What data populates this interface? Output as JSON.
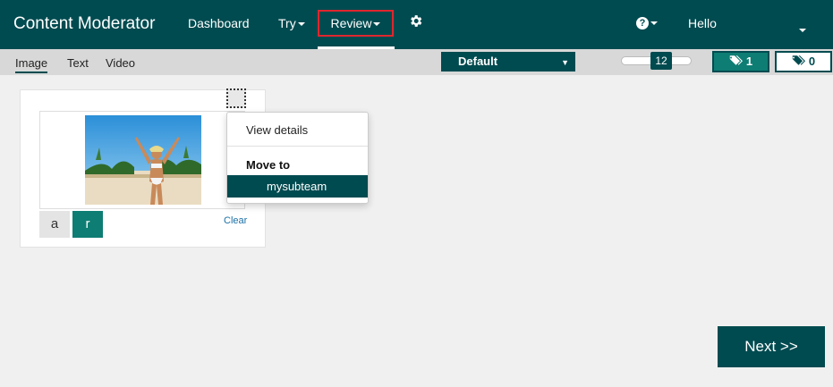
{
  "header": {
    "brand": "Content Moderator",
    "nav": {
      "dashboard": "Dashboard",
      "try": "Try",
      "review": "Review"
    },
    "user_greeting": "Hello"
  },
  "subbar": {
    "media_tabs": [
      "Image",
      "Text",
      "Video"
    ],
    "active_media_tab": "Image",
    "team_select": "Default",
    "page_size": "12",
    "tag_count_on": "1",
    "tag_count_off": "0"
  },
  "card": {
    "tag_a": "a",
    "tag_r": "r",
    "clear_label": "Clear"
  },
  "context_menu": {
    "view_details": "View details",
    "move_to_header": "Move to",
    "subteam": "mysubteam"
  },
  "footer": {
    "next_label": "Next >>"
  },
  "colors": {
    "primary": "#004b50",
    "accent": "#0e7d73",
    "highlight_border": "#e0262e",
    "link": "#1a6fa6"
  },
  "icons": [
    "gear-icon",
    "help-icon",
    "tag-icon",
    "chevron-down-icon"
  ]
}
